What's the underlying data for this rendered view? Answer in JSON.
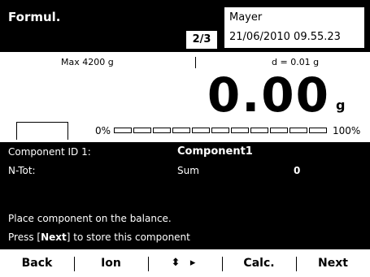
{
  "header": {
    "title": "Formul.",
    "page_indicator": "2/3",
    "user": "Mayer",
    "timestamp": "21/06/2010 09.55.23"
  },
  "weighing": {
    "max_label": "Max 4200 g",
    "d_label": "d = 0.01 g",
    "value": "0.00",
    "unit": "g",
    "pct_min": "0%",
    "pct_max": "100%",
    "load_fraction": 0
  },
  "panel": {
    "component_id_label": "Component ID 1:",
    "component_id_value": "Component1",
    "ntot_label": "N-Tot:",
    "sum_label": "Sum",
    "sum_value": "0",
    "message1": "Place component on the balance.",
    "message2_pre": "Press [",
    "message2_key": "Next",
    "message2_post": "] to store this component"
  },
  "softkeys": {
    "back": "Back",
    "ion": "Ion",
    "arrows": "⬍ ▸",
    "calc": "Calc.",
    "next": "Next"
  },
  "colors": {
    "background": "#ffffff",
    "panel": "#000000",
    "text_on_panel": "#ffffff"
  }
}
